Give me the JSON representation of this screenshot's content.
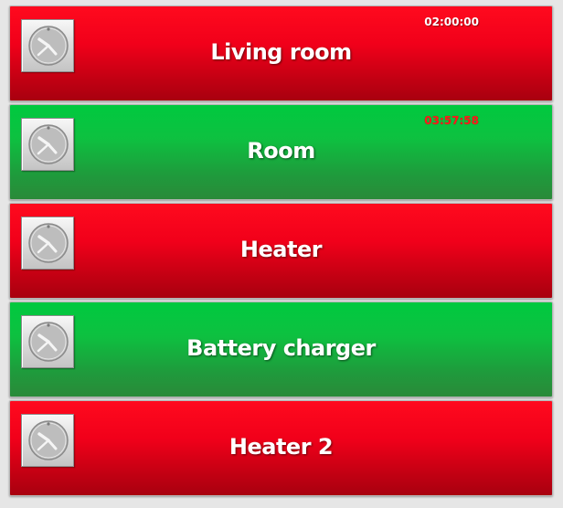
{
  "devices": [
    {
      "name": "Living room",
      "state": "off",
      "timer": "02:00:00",
      "timer_style": "white",
      "icon": "clock-icon"
    },
    {
      "name": "Room",
      "state": "on",
      "timer": "03:57:58",
      "timer_style": "red",
      "icon": "clock-icon"
    },
    {
      "name": "Heater",
      "state": "off",
      "timer": "",
      "icon": "clock-icon"
    },
    {
      "name": "Battery charger",
      "state": "on",
      "timer": "",
      "icon": "clock-icon"
    },
    {
      "name": "Heater 2",
      "state": "off",
      "timer": "",
      "icon": "clock-icon"
    }
  ],
  "colors": {
    "off": "#e8001a",
    "on": "#16b040",
    "timer_white": "#ffffff",
    "timer_red": "#ff1a1a"
  }
}
